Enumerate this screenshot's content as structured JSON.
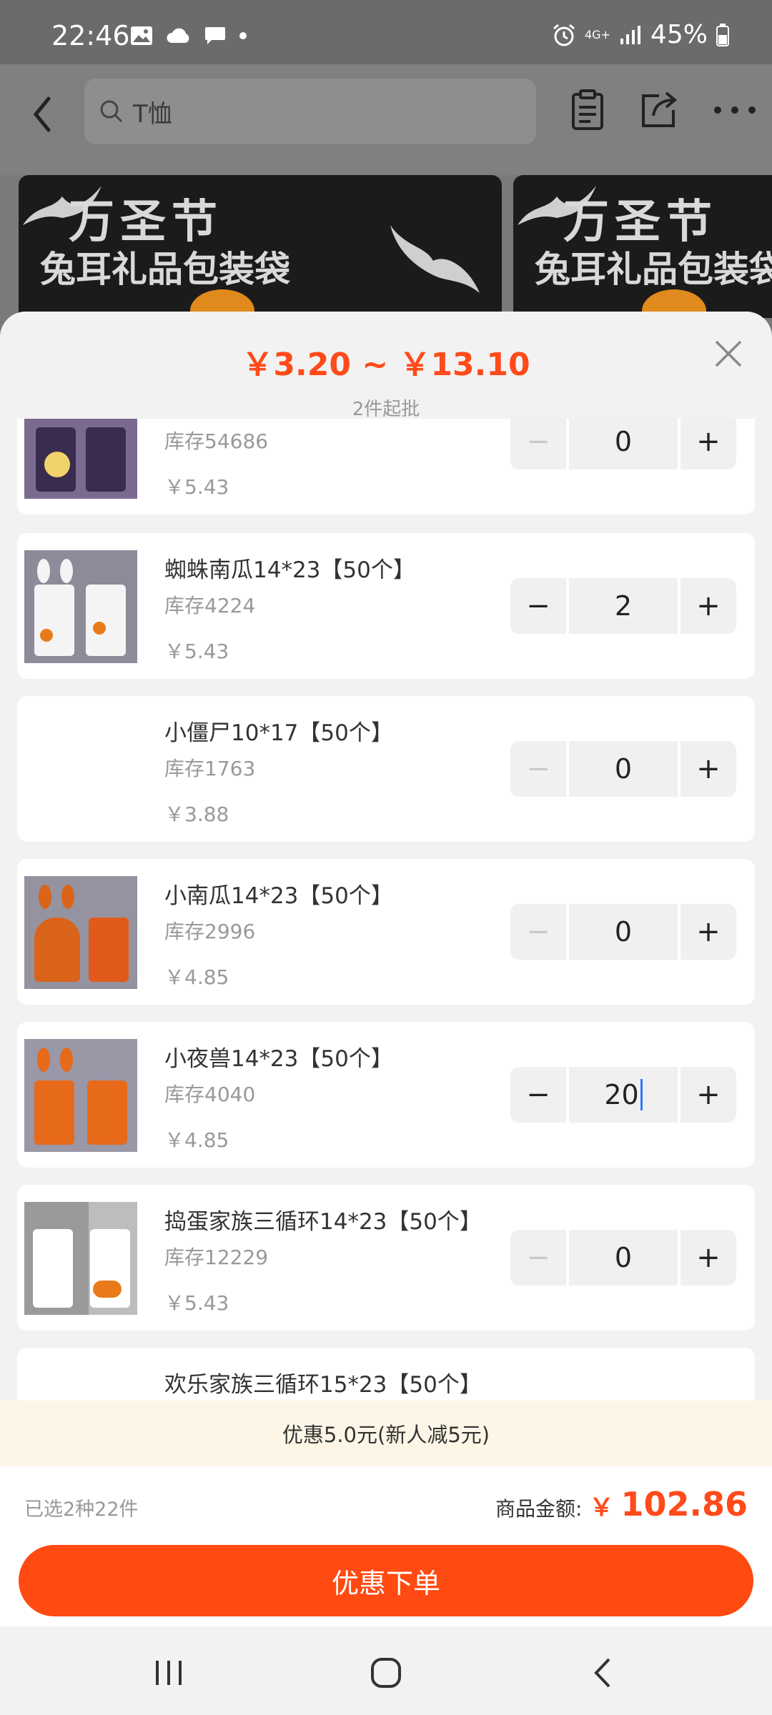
{
  "status_bar": {
    "time": "22:46",
    "network": "4G+",
    "battery": "45%"
  },
  "search": {
    "placeholder": "T恤"
  },
  "banners": [
    {
      "title": "万圣节",
      "subtitle": "兔耳礼品包装袋"
    },
    {
      "title": "万圣节",
      "subtitle": "兔耳礼品包装袋"
    }
  ],
  "sheet": {
    "price_range": "￥3.20 ~ ￥13.10",
    "min_batch": "2件起批"
  },
  "products": [
    {
      "name": "",
      "stock": "库存54686",
      "price": "￥5.43",
      "qty": "0",
      "minus_disabled": true
    },
    {
      "name": "蜘蛛南瓜14*23【50个】",
      "stock": "库存4224",
      "price": "￥5.43",
      "qty": "2",
      "minus_disabled": false
    },
    {
      "name": "小僵尸10*17【50个】",
      "stock": "库存1763",
      "price": "￥3.88",
      "qty": "0",
      "minus_disabled": true
    },
    {
      "name": "小南瓜14*23【50个】",
      "stock": "库存2996",
      "price": "￥4.85",
      "qty": "0",
      "minus_disabled": true
    },
    {
      "name": "小夜兽14*23【50个】",
      "stock": "库存4040",
      "price": "￥4.85",
      "qty": "20",
      "minus_disabled": false
    },
    {
      "name": "捣蛋家族三循环14*23【50个】",
      "stock": "库存12229",
      "price": "￥5.43",
      "qty": "0",
      "minus_disabled": true
    },
    {
      "name": "欢乐家族三循环15*23【50个】",
      "stock": "",
      "price": "",
      "qty": "",
      "minus_disabled": true
    }
  ],
  "stepper": {
    "minus": "−",
    "plus": "+"
  },
  "promo": {
    "text": "优惠5.0元(新人减5元)"
  },
  "footer": {
    "selected": "已选2种22件",
    "total_label": "商品金额:",
    "currency": "￥",
    "total_amount": "102.86",
    "order_button": "优惠下单"
  },
  "colors": {
    "accent": "#ff4a12",
    "price": "#ff4a1a"
  }
}
